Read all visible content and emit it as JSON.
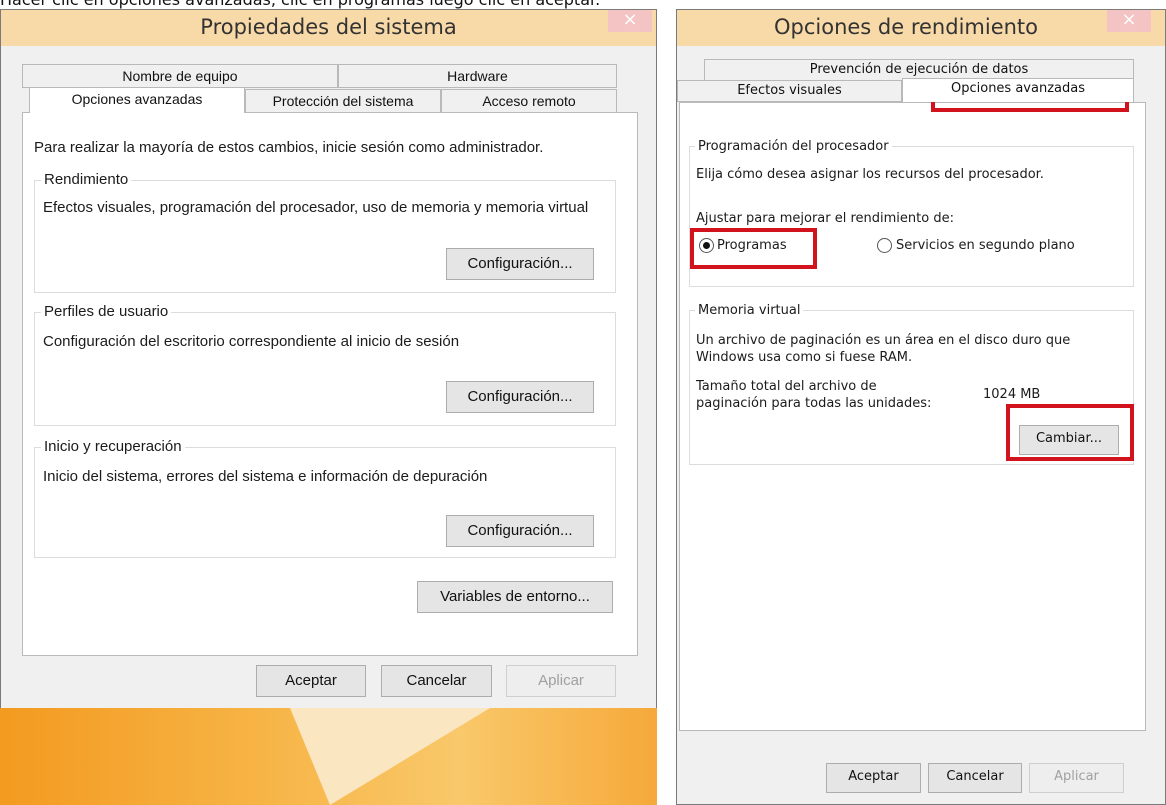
{
  "caption": "Hacer clic en opciones avanzadas, clic en programas luego clic en aceptar.",
  "left_window": {
    "title": "Propiedades del sistema",
    "close_glyph": "×",
    "tabs_back": [
      "Nombre de equipo",
      "Hardware"
    ],
    "tabs_front": [
      "Opciones avanzadas",
      "Protección del sistema",
      "Acceso remoto"
    ],
    "admin_note": "Para realizar la mayoría de estos cambios, inicie sesión como administrador.",
    "groups": {
      "rendimiento": {
        "label": "Rendimiento",
        "text": "Efectos visuales, programación del procesador, uso de memoria y memoria virtual",
        "button": "Configuración..."
      },
      "perfiles": {
        "label": "Perfiles de usuario",
        "text": "Configuración del escritorio correspondiente al inicio de sesión",
        "button": "Configuración..."
      },
      "inicio": {
        "label": "Inicio y recuperación",
        "text": "Inicio del sistema, errores del sistema e información de depuración",
        "button": "Configuración..."
      }
    },
    "env_button": "Variables de entorno...",
    "footer": {
      "ok": "Aceptar",
      "cancel": "Cancelar",
      "apply": "Aplicar"
    }
  },
  "right_window": {
    "title": "Opciones de rendimiento",
    "close_glyph": "×",
    "tab_back": "Prevención de ejecución de datos",
    "tabs_front": [
      "Efectos visuales",
      "Opciones avanzadas"
    ],
    "processor": {
      "label": "Programación del procesador",
      "desc": "Elija cómo desea asignar los recursos del procesador.",
      "adjust": "Ajustar para mejorar el rendimiento de:",
      "option_programs": "Programas",
      "option_services": "Servicios en segundo plano",
      "selected": "Programas"
    },
    "virtual_memory": {
      "label": "Memoria virtual",
      "desc": "Un archivo de paginación es un área en el disco duro que Windows usa como si fuese RAM.",
      "total_label_1": "Tamaño total del archivo de",
      "total_label_2": "paginación para todas las unidades:",
      "total_value": "1024 MB",
      "change_button": "Cambiar..."
    },
    "footer": {
      "ok": "Aceptar",
      "cancel": "Cancelar",
      "apply": "Aplicar"
    }
  },
  "colors": {
    "highlight": "#d0131c",
    "titlebar": "#f8d9a8",
    "close": "#f4c4c4"
  }
}
